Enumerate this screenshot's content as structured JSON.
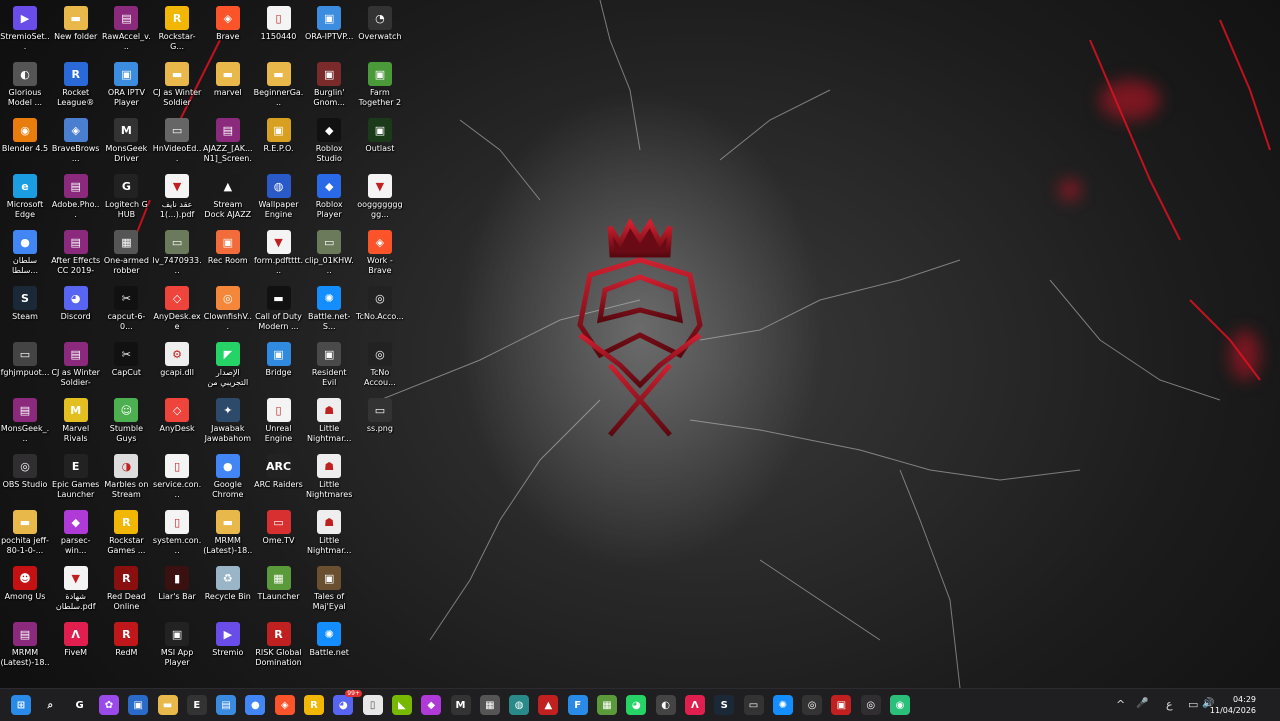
{
  "desktop": {
    "columns": [
      [
        {
          "label": "StremioSet...",
          "icon": "stremio-installer-icon",
          "color": "#6a4de8",
          "glyph": "▶"
        },
        {
          "label": "Glorious Model ...",
          "icon": "mouse-icon",
          "color": "#555555",
          "glyph": "◐"
        },
        {
          "label": "Blender 4.5",
          "icon": "blender-icon",
          "color": "#e87d0d",
          "glyph": "◉"
        },
        {
          "label": "Microsoft Edge",
          "icon": "edge-icon",
          "color": "#1b9de2",
          "glyph": "e"
        },
        {
          "label": "سلطان سلطا...",
          "icon": "chrome-icon",
          "color": "#4285f4",
          "glyph": "●"
        },
        {
          "label": "Steam",
          "icon": "steam-icon",
          "color": "#1b2838",
          "glyph": "S"
        },
        {
          "label": "fghjmpuot...",
          "icon": "image-file-icon",
          "color": "#444444",
          "glyph": "▭"
        },
        {
          "label": "MonsGeek_...",
          "icon": "winrar-icon",
          "color": "#8b2a7c",
          "glyph": "▤"
        },
        {
          "label": "OBS Studio",
          "icon": "obs-icon",
          "color": "#302e31",
          "glyph": "◎"
        },
        {
          "label": "pochita jeff-80-1-0-...",
          "icon": "folder-icon",
          "color": "#e8b84a",
          "glyph": "▬"
        },
        {
          "label": "Among Us",
          "icon": "among-us-icon",
          "color": "#c51111",
          "glyph": "☻"
        },
        {
          "label": "MRMM (Latest)-18...",
          "icon": "winrar-icon",
          "color": "#8b2a7c",
          "glyph": "▤"
        }
      ],
      [
        {
          "label": "New folder",
          "icon": "folder-icon",
          "color": "#e8b84a",
          "glyph": "▬"
        },
        {
          "label": "Rocket League®",
          "icon": "rocket-league-icon",
          "color": "#2a6ad8",
          "glyph": "R"
        },
        {
          "label": "BraveBrows...",
          "icon": "brave-installer-icon",
          "color": "#4a7fd0",
          "glyph": "◈"
        },
        {
          "label": "Adobe.Pho...",
          "icon": "winrar-icon",
          "color": "#8b2a7c",
          "glyph": "▤"
        },
        {
          "label": "After Effects CC 2019-20...",
          "icon": "winrar-icon",
          "color": "#8b2a7c",
          "glyph": "▤"
        },
        {
          "label": "Discord",
          "icon": "discord-icon",
          "color": "#5865f2",
          "glyph": "◕"
        },
        {
          "label": "CJ as Winter Soldier-63-...",
          "icon": "winrar-icon",
          "color": "#8b2a7c",
          "glyph": "▤"
        },
        {
          "label": "Marvel Rivals",
          "icon": "marvel-rivals-icon",
          "color": "#e3c020",
          "glyph": "M"
        },
        {
          "label": "Epic Games Launcher",
          "icon": "epic-games-icon",
          "color": "#222222",
          "glyph": "E"
        },
        {
          "label": "parsec-win...",
          "icon": "parsec-icon",
          "color": "#b03ad8",
          "glyph": "◆"
        },
        {
          "label": "شهادة سلطان.pdf",
          "icon": "pdf-icon",
          "color": "#f4f4f4",
          "glyph": "▼"
        },
        {
          "label": "FiveM",
          "icon": "fivem-icon",
          "color": "#e01f4e",
          "glyph": "Λ"
        }
      ],
      [
        {
          "label": "RawAccel_v...",
          "icon": "winrar-icon",
          "color": "#8b2a7c",
          "glyph": "▤"
        },
        {
          "label": "ORA IPTV Player",
          "icon": "iptv-icon",
          "color": "#3c8de0",
          "glyph": "▣"
        },
        {
          "label": "MonsGeek Driver",
          "icon": "monsgeek-icon",
          "color": "#333333",
          "glyph": "M"
        },
        {
          "label": "Logitech G HUB",
          "icon": "logitech-icon",
          "color": "#222222",
          "glyph": "G"
        },
        {
          "label": "One-armed robber",
          "icon": "game-icon",
          "color": "#555555",
          "glyph": "▦"
        },
        {
          "label": "capcut-6-0...",
          "icon": "capcut-icon",
          "color": "#111111",
          "glyph": "✂"
        },
        {
          "label": "CapCut",
          "icon": "capcut-icon",
          "color": "#111111",
          "glyph": "✂"
        },
        {
          "label": "Stumble Guys",
          "icon": "stumble-guys-icon",
          "color": "#4caf50",
          "glyph": "☺"
        },
        {
          "label": "Marbles on Stream",
          "icon": "marbles-icon",
          "color": "#dddddd",
          "glyph": "◑"
        },
        {
          "label": "Rockstar Games ...",
          "icon": "rockstar-icon",
          "color": "#f2b705",
          "glyph": "R"
        },
        {
          "label": "Red Dead Online",
          "icon": "rdo-icon",
          "color": "#8a1010",
          "glyph": "R"
        },
        {
          "label": "RedM",
          "icon": "redm-icon",
          "color": "#c0171b",
          "glyph": "R"
        }
      ],
      [
        {
          "label": "Rockstar-G...",
          "icon": "rockstar-icon",
          "color": "#f2b705",
          "glyph": "R"
        },
        {
          "label": "CJ as Winter Soldier",
          "icon": "folder-icon",
          "color": "#e8b84a",
          "glyph": "▬"
        },
        {
          "label": "HnVideoEd...",
          "icon": "video-file-icon",
          "color": "#666666",
          "glyph": "▭"
        },
        {
          "label": "عقد نايف 1(...).pdf",
          "icon": "pdf-icon",
          "color": "#f4f4f4",
          "glyph": "▼"
        },
        {
          "label": "lv_7470933...",
          "icon": "video-file-icon",
          "color": "#6a7a5a",
          "glyph": "▭"
        },
        {
          "label": "AnyDesk.exe",
          "icon": "anydesk-icon",
          "color": "#ef443b",
          "glyph": "◇"
        },
        {
          "label": "gcapi.dll",
          "icon": "dll-file-icon",
          "color": "#eeeeee",
          "glyph": "⚙"
        },
        {
          "label": "AnyDesk",
          "icon": "anydesk-icon",
          "color": "#ef443b",
          "glyph": "◇"
        },
        {
          "label": "service.con...",
          "icon": "file-icon",
          "color": "#f4f4f4",
          "glyph": "▯"
        },
        {
          "label": "system.con...",
          "icon": "file-icon",
          "color": "#f4f4f4",
          "glyph": "▯"
        },
        {
          "label": "Liar's Bar",
          "icon": "liars-bar-icon",
          "color": "#3a1010",
          "glyph": "▮"
        },
        {
          "label": "MSI App Player",
          "icon": "msi-player-icon",
          "color": "#222222",
          "glyph": "▣"
        }
      ],
      [
        {
          "label": "Brave",
          "icon": "brave-icon",
          "color": "#fb542b",
          "glyph": "◈"
        },
        {
          "label": "marvel",
          "icon": "folder-icon",
          "color": "#e8b84a",
          "glyph": "▬"
        },
        {
          "label": "AJAZZ_[AK... N1]_Screen...",
          "icon": "winrar-icon",
          "color": "#8b2a7c",
          "glyph": "▤"
        },
        {
          "label": "Stream Dock AJAZZ",
          "icon": "stream-dock-icon",
          "color": "#1a1a1a",
          "glyph": "▲"
        },
        {
          "label": "Rec Room",
          "icon": "rec-room-icon",
          "color": "#f26b3a",
          "glyph": "▣"
        },
        {
          "label": "ClownfishV...",
          "icon": "clownfish-icon",
          "color": "#f5873b",
          "glyph": "◎"
        },
        {
          "label": "الإصدار التجريبي من ...",
          "icon": "whatsapp-beta-icon",
          "color": "#25d366",
          "glyph": "◤"
        },
        {
          "label": "Jawabak Jawabahom",
          "icon": "jawabak-icon",
          "color": "#2e4a6a",
          "glyph": "✦"
        },
        {
          "label": "Google Chrome",
          "icon": "chrome-icon",
          "color": "#4285f4",
          "glyph": "●"
        },
        {
          "label": "MRMM (Latest)-18...",
          "icon": "folder-icon",
          "color": "#e8b84a",
          "glyph": "▬"
        },
        {
          "label": "Recycle Bin",
          "icon": "recycle-bin-icon",
          "color": "#9ab4c8",
          "glyph": "♻"
        },
        {
          "label": "Stremio",
          "icon": "stremio-icon",
          "color": "#6a4de8",
          "glyph": "▶"
        }
      ],
      [
        {
          "label": "1150440",
          "icon": "file-icon",
          "color": "#f4f4f4",
          "glyph": "▯"
        },
        {
          "label": "BeginnerGa...",
          "icon": "folder-icon",
          "color": "#e8b84a",
          "glyph": "▬"
        },
        {
          "label": "R.E.P.O.",
          "icon": "repo-icon",
          "color": "#d8a020",
          "glyph": "▣"
        },
        {
          "label": "Wallpaper Engine",
          "icon": "wallpaper-engine-icon",
          "color": "#2a5ac8",
          "glyph": "◍"
        },
        {
          "label": "form.pdftttt...",
          "icon": "pdf-icon",
          "color": "#f4f4f4",
          "glyph": "▼"
        },
        {
          "label": "Call of Duty Modern ...",
          "icon": "cod-icon",
          "color": "#111111",
          "glyph": "▬"
        },
        {
          "label": "Bridge",
          "icon": "bridge-icon",
          "color": "#2f8ae0",
          "glyph": "▣"
        },
        {
          "label": "Unreal Engine",
          "icon": "file-icon",
          "color": "#f4f4f4",
          "glyph": "▯"
        },
        {
          "label": "ARC Raiders",
          "icon": "arc-raiders-icon",
          "color": "#222222",
          "glyph": "ARC"
        },
        {
          "label": "Ome.TV",
          "icon": "ometv-icon",
          "color": "#d83030",
          "glyph": "▭"
        },
        {
          "label": "TLauncher",
          "icon": "tlauncher-icon",
          "color": "#5a9a3a",
          "glyph": "▦"
        },
        {
          "label": "RISK Global Domination",
          "icon": "risk-icon",
          "color": "#c02020",
          "glyph": "R"
        }
      ],
      [
        {
          "label": "ORA-IPTVP...",
          "icon": "iptv-installer-icon",
          "color": "#3c8de0",
          "glyph": "▣"
        },
        {
          "label": "Burglin' Gnom...",
          "icon": "burglin-gnomes-icon",
          "color": "#7a2a2a",
          "glyph": "▣"
        },
        {
          "label": "Roblox Studio",
          "icon": "roblox-studio-icon",
          "color": "#111111",
          "glyph": "◆"
        },
        {
          "label": "Roblox Player",
          "icon": "roblox-icon",
          "color": "#2a6ae8",
          "glyph": "◆"
        },
        {
          "label": "clip_01KHW...",
          "icon": "video-file-icon",
          "color": "#6a7a5a",
          "glyph": "▭"
        },
        {
          "label": "Battle.net-S...",
          "icon": "battlenet-icon",
          "color": "#148eff",
          "glyph": "✺"
        },
        {
          "label": "Resident Evil Requiem",
          "icon": "resident-evil-icon",
          "color": "#4a4a4a",
          "glyph": "▣"
        },
        {
          "label": "Little Nightmar...",
          "icon": "little-nightmares-icon",
          "color": "#eeeeee",
          "glyph": "☗"
        },
        {
          "label": "Little Nightmares",
          "icon": "little-nightmares-icon",
          "color": "#eeeeee",
          "glyph": "☗"
        },
        {
          "label": "Little Nightmar...",
          "icon": "little-nightmares-icon",
          "color": "#eeeeee",
          "glyph": "☗"
        },
        {
          "label": "Tales of Maj'Eyal",
          "icon": "tome-icon",
          "color": "#6a5030",
          "glyph": "▣"
        },
        {
          "label": "Battle.net",
          "icon": "battlenet-icon",
          "color": "#148eff",
          "glyph": "✺"
        }
      ],
      [
        {
          "label": "Overwatch",
          "icon": "overwatch-icon",
          "color": "#333333",
          "glyph": "◔"
        },
        {
          "label": "Farm Together 2",
          "icon": "farm-together-icon",
          "color": "#4a9a3a",
          "glyph": "▣"
        },
        {
          "label": "Outlast",
          "icon": "outlast-icon",
          "color": "#1a3a1a",
          "glyph": "▣"
        },
        {
          "label": "ooggggggggg...",
          "icon": "pdf-icon",
          "color": "#f4f4f4",
          "glyph": "▼"
        },
        {
          "label": "Work - Brave",
          "icon": "brave-icon",
          "color": "#fb542b",
          "glyph": "◈"
        },
        {
          "label": "TcNo.Acco...",
          "icon": "tcno-icon",
          "color": "#222222",
          "glyph": "◎"
        },
        {
          "label": "TcNo Accou...",
          "icon": "tcno-icon",
          "color": "#222222",
          "glyph": "◎"
        },
        {
          "label": "ss.png",
          "icon": "image-file-icon",
          "color": "#333333",
          "glyph": "▭"
        }
      ]
    ]
  },
  "taskbar": {
    "items": [
      {
        "name": "start-icon",
        "glyph": "⊞",
        "color": "#2a8ae8"
      },
      {
        "name": "search-icon",
        "glyph": "⌕",
        "color": "#1f1f22"
      },
      {
        "name": "copilot-icon",
        "glyph": "G",
        "color": "#1f1f22"
      },
      {
        "name": "ai-app-icon",
        "glyph": "✿",
        "color": "#9a4ae8"
      },
      {
        "name": "store-icon",
        "glyph": "▣",
        "color": "#2a6ac8"
      },
      {
        "name": "file-explorer-icon",
        "glyph": "▬",
        "color": "#e8b84a"
      },
      {
        "name": "epic-games-icon",
        "glyph": "E",
        "color": "#333333"
      },
      {
        "name": "notepad-icon",
        "glyph": "▤",
        "color": "#3a8ae0"
      },
      {
        "name": "chrome-icon",
        "glyph": "●",
        "color": "#4285f4"
      },
      {
        "name": "brave-icon",
        "glyph": "◈",
        "color": "#fb542b"
      },
      {
        "name": "rockstar-icon",
        "glyph": "R",
        "color": "#f2b705"
      },
      {
        "name": "discord-icon",
        "glyph": "◕",
        "color": "#5865f2"
      },
      {
        "name": "file-icon",
        "glyph": "▯",
        "color": "#e8e8e8"
      },
      {
        "name": "nvidia-icon",
        "glyph": "◣",
        "color": "#76b900"
      },
      {
        "name": "parsec-icon",
        "glyph": "◆",
        "color": "#b03ad8"
      },
      {
        "name": "monsgeek-icon",
        "glyph": "M",
        "color": "#333333"
      },
      {
        "name": "image-viewer-icon",
        "glyph": "▦",
        "color": "#555555"
      },
      {
        "name": "globe-icon",
        "glyph": "◍",
        "color": "#2a8a8a"
      },
      {
        "name": "stream-dock-icon",
        "glyph": "▲",
        "color": "#c02020"
      },
      {
        "name": "f-app-icon",
        "glyph": "F",
        "color": "#2a8ae8"
      },
      {
        "name": "minecraft-icon",
        "glyph": "▦",
        "color": "#5a9a3a"
      },
      {
        "name": "whatsapp-icon",
        "glyph": "◕",
        "color": "#25d366"
      },
      {
        "name": "mouse-icon",
        "glyph": "◐",
        "color": "#444444"
      },
      {
        "name": "fivem-icon",
        "glyph": "Λ",
        "color": "#e01f4e"
      },
      {
        "name": "steam-icon",
        "glyph": "S",
        "color": "#1b2838"
      },
      {
        "name": "capture-icon",
        "glyph": "▭",
        "color": "#333333"
      },
      {
        "name": "battlenet-icon",
        "glyph": "✺",
        "color": "#148eff"
      },
      {
        "name": "tcno-icon",
        "glyph": "◎",
        "color": "#333333"
      },
      {
        "name": "msi-player-icon",
        "glyph": "▣",
        "color": "#c02020"
      },
      {
        "name": "obs-icon",
        "glyph": "◎",
        "color": "#302e31"
      },
      {
        "name": "spotify-like-icon",
        "glyph": "◉",
        "color": "#2ac07a"
      }
    ],
    "tray": {
      "chevron": "^",
      "mic": "🎤",
      "lang": "ع",
      "network": "▭",
      "volume": "🔊"
    },
    "clock": {
      "time": "04:29",
      "date": "11/04/2026"
    },
    "discord_badge": "99+"
  }
}
